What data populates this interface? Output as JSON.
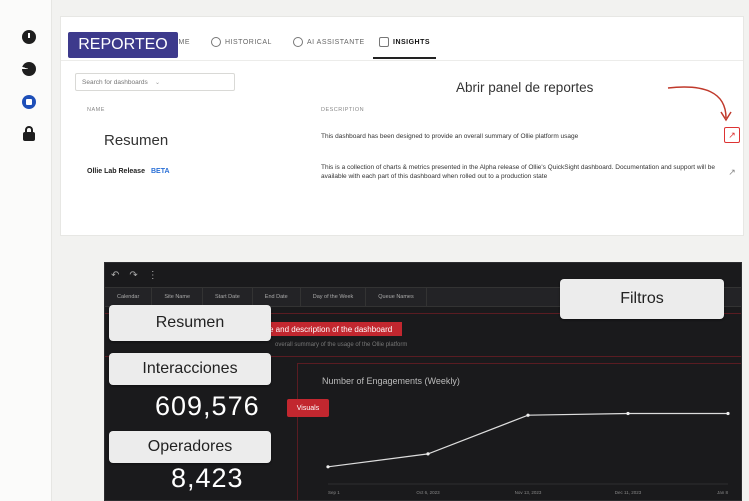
{
  "sidebar": {
    "icons": [
      "clock-icon",
      "pie-chart-icon",
      "assistant-icon",
      "lock-icon"
    ]
  },
  "header": {
    "overlay_title": "REPORTEO",
    "tabs": [
      {
        "label": "HOME"
      },
      {
        "label": "HISTORICAL"
      },
      {
        "label": "AI ASSISTANTE"
      },
      {
        "label": "INSIGHTS"
      }
    ]
  },
  "search": {
    "placeholder": "Search for dashboards"
  },
  "table": {
    "col_name": "NAME",
    "col_description": "DESCRIPTION",
    "rows": [
      {
        "name": "",
        "description": "This dashboard has been designed to provide an overall summary of Ollie platform usage"
      },
      {
        "name": "Ollie Lab Release",
        "badge": "BETA",
        "description": "This is a collection of charts & metrics presented in the Alpha release of Ollie's QuickSight dashboard. Documentation and support will be available with each part of this dashboard when rolled out to a production state"
      }
    ]
  },
  "annotations": {
    "resumen_top": "Resumen",
    "abrir_panel": "Abrir panel de reportes",
    "filtros": "Filtros",
    "resumen_card": "Resumen",
    "interacciones": "Interacciones",
    "operadores": "Operadores",
    "visuals": "Visuals"
  },
  "dashboard": {
    "toolbar": [
      "↶",
      "↷",
      "⋮"
    ],
    "filters": [
      "Calendar",
      "Site Name",
      "Start Date",
      "End Date",
      "Day of the Week",
      "Queue Names"
    ],
    "title_banner": "e and description of the dashboard",
    "subtitle": "overall summary of the usage of the Ollie platform",
    "chart_title": "Number of Engagements (Weekly)",
    "interactions_value": "609,576",
    "operators_value": "8,423"
  },
  "chart_data": {
    "type": "line",
    "title": "Number of Engagements (Weekly)",
    "x": [
      "Sep 1",
      "Oct 6, 2023",
      "Nov 13, 2023",
      "Dec 11, 2023",
      "Jan 8"
    ],
    "values": [
      20,
      35,
      80,
      82,
      82
    ]
  },
  "colors": {
    "accent_red": "#c2272f",
    "overlay_purple": "#3d3a8c",
    "dark_bg": "#1a1a1c"
  }
}
